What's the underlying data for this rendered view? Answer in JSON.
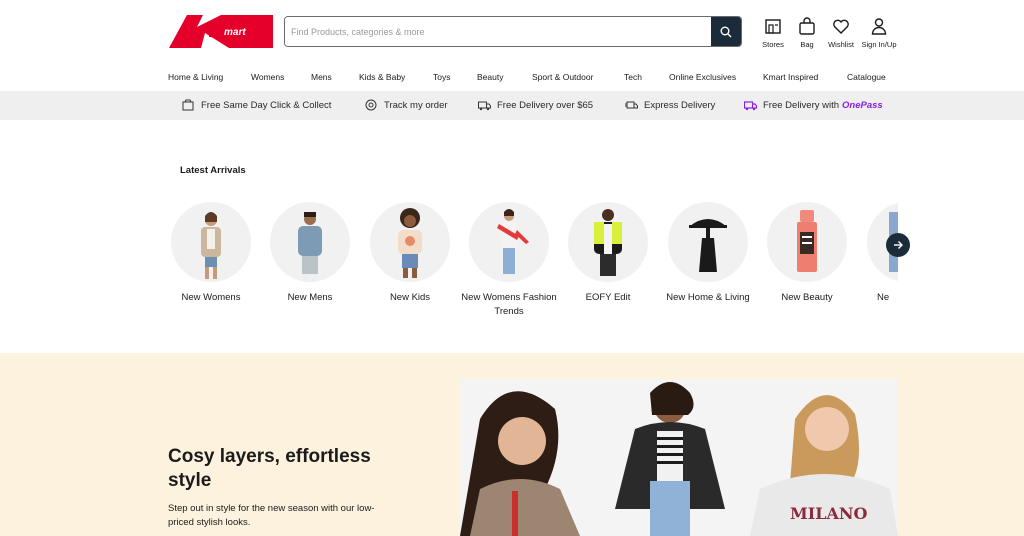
{
  "header": {
    "search_placeholder": "Find Products, categories & more",
    "utilities": [
      {
        "label": "Stores",
        "icon": "store-icon"
      },
      {
        "label": "Bag",
        "icon": "bag-icon"
      },
      {
        "label": "Wishlist",
        "icon": "heart-icon"
      },
      {
        "label": "Sign In/Up",
        "icon": "user-icon"
      }
    ]
  },
  "nav": [
    "Home & Living",
    "Womens",
    "Mens",
    "Kids & Baby",
    "Toys",
    "Beauty",
    "Sport & Outdoor",
    "Tech",
    "Online Exclusives",
    "Kmart Inspired",
    "Catalogue"
  ],
  "promo": [
    {
      "label": "Free Same Day Click & Collect",
      "icon": "click-collect-icon"
    },
    {
      "label": "Track my order",
      "icon": "track-order-icon"
    },
    {
      "label": "Free Delivery over $65",
      "icon": "delivery-truck-icon"
    },
    {
      "label": "Express Delivery",
      "icon": "express-truck-icon"
    },
    {
      "label": "Free Delivery with",
      "icon": "onepass-truck-icon",
      "brand": "OnePass"
    }
  ],
  "latest": {
    "title": "Latest Arrivals",
    "tiles": [
      "New Womens",
      "New Mens",
      "New Kids",
      "New Womens Fashion Trends",
      "EOFY Edit",
      "New Home & Living",
      "New Beauty",
      "Ne"
    ]
  },
  "hero": {
    "title": "Cosy layers, effortless style",
    "text": "Step out in style for the new season with our low-priced stylish looks."
  },
  "colors": {
    "brand_red": "#e4002b",
    "navy": "#1c2b3a",
    "promo_bg": "#efefef",
    "hero_bg": "#fdf2de",
    "onepass": "#8a20e3"
  }
}
